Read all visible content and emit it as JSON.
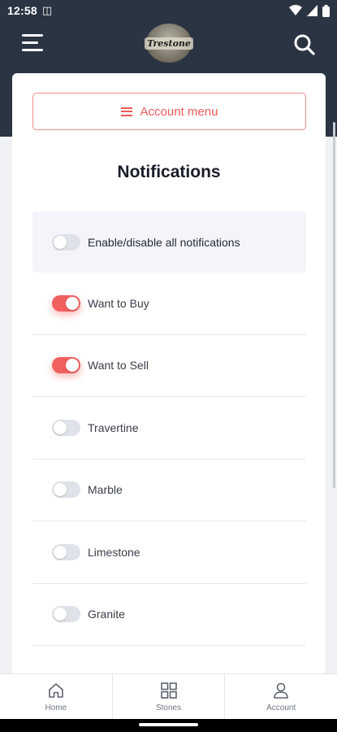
{
  "status_bar": {
    "time": "12:58",
    "sim_icon": "sim-card-icon",
    "icons": [
      "wifi-icon",
      "signal-icon",
      "battery-icon"
    ]
  },
  "header": {
    "logo_text": "Trestone"
  },
  "account_menu": {
    "label": "Account menu"
  },
  "page": {
    "title": "Notifications"
  },
  "notifications": [
    {
      "label": "Enable/disable all notifications",
      "enabled": false
    },
    {
      "label": "Want to Buy",
      "enabled": true
    },
    {
      "label": "Want to Sell",
      "enabled": true
    },
    {
      "label": "Travertine",
      "enabled": false
    },
    {
      "label": "Marble",
      "enabled": false
    },
    {
      "label": "Limestone",
      "enabled": false
    },
    {
      "label": "Granite",
      "enabled": false
    }
  ],
  "bottom_nav": [
    {
      "label": "Home",
      "icon": "home-icon"
    },
    {
      "label": "Stones",
      "icon": "grid-icon"
    },
    {
      "label": "Account",
      "icon": "user-icon"
    }
  ],
  "colors": {
    "header_bg": "#2b3442",
    "accent": "#f25f5f",
    "toggle_off": "#dfe2e8"
  }
}
